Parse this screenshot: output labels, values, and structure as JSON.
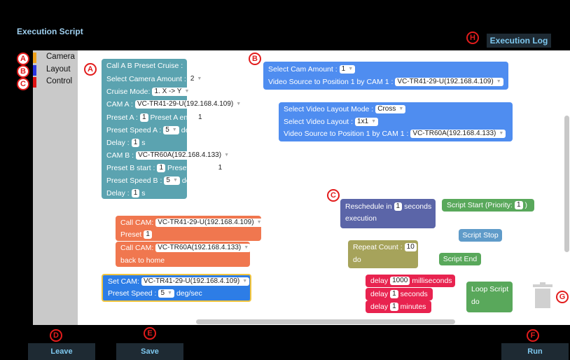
{
  "header": {
    "title": "Execution Script",
    "execution_log_label": "Execution Log"
  },
  "categories": [
    {
      "label": "Camera",
      "color": "#f0a21a"
    },
    {
      "label": "Layout",
      "color": "#2a35e0"
    },
    {
      "label": "Control",
      "color": "#e01414"
    }
  ],
  "markers": {
    "a": "A",
    "b": "B",
    "c": "C",
    "d": "D",
    "e": "E",
    "f": "F",
    "g": "G",
    "h": "H"
  },
  "cruise_block": {
    "title": "Call A B Preset Cruise :",
    "camera_amount_label": "Select Camera Amount :",
    "camera_amount_value": "2",
    "mode_label": "Cruise Mode:",
    "mode_value": "1. X -> Y",
    "cam_a_label": "CAM A :",
    "cam_a_value": "VC-TR41-29-U(192.168.4.109)",
    "preset_a_label": "Preset A :",
    "preset_a_value": "1",
    "preset_a_end_label": "Preset A end:",
    "preset_a_end_value": "1",
    "speed_a_label": "Preset Speed A :",
    "speed_a_value": "5",
    "speed_unit": "deg/sec",
    "delay_label": "Delay :",
    "delay_value": "1",
    "delay_unit": "s",
    "cam_b_label": "CAM B :",
    "cam_b_value": "VC-TR60A(192.168.4.133)",
    "preset_b_label": "Preset B start :",
    "preset_b_value": "1",
    "preset_b_end_label": "Preset B end :",
    "preset_b_end_value": "1",
    "speed_b_label": "Preset Speed B :",
    "speed_b_value": "5"
  },
  "cam_source_block": {
    "amount_label": "Select Cam Amount :",
    "amount_value": "1",
    "source_label": "Video Source to Position  1  by CAM 1  :",
    "source_value": "VC-TR41-29-U(192.168.4.109)"
  },
  "layout_block": {
    "mode_label": "Select Video Layout Mode :",
    "mode_value": "Cross",
    "layout_label": "Select Video Layout :",
    "layout_value": "1x1",
    "source_label": "Video Source to Position  1  by CAM 1  :",
    "source_value": "VC-TR60A(192.168.4.133)"
  },
  "call_cam_block": {
    "label": "Call CAM:",
    "cam1": "VC-TR41-29-U(192.168.4.109)",
    "preset_label": "Preset",
    "preset_value": "1",
    "cam2": "VC-TR60A(192.168.4.133)",
    "home_label": "back to home"
  },
  "set_cam_block": {
    "label": "Set CAM:",
    "cam": "VC-TR41-29-U(192.168.4.109)",
    "speed_label": "Preset Speed :",
    "speed_value": "5",
    "speed_unit": "deg/sec"
  },
  "control": {
    "reschedule_label": "Reschedule in",
    "reschedule_value": "1",
    "reschedule_unit": "seconds",
    "execution_label": "execution",
    "script_start_label": "Script Start (Priority:",
    "script_start_value": "1",
    "script_start_close": ")",
    "script_stop_label": "Script Stop",
    "repeat_label": "Repeat Count :",
    "repeat_value": "10",
    "do_label": "do",
    "script_end_label": "Script End",
    "delay_label": "delay",
    "delay_ms_value": "1000",
    "delay_ms_unit": "milliseconds",
    "delay_s_value": "1",
    "delay_s_unit": "seconds",
    "delay_m_value": "1",
    "delay_m_unit": "minutes",
    "loop_label": "Loop Script",
    "loop_do_label": "do"
  },
  "footer": {
    "leave_label": "Leave",
    "save_label": "Save",
    "run_label": "Run"
  }
}
